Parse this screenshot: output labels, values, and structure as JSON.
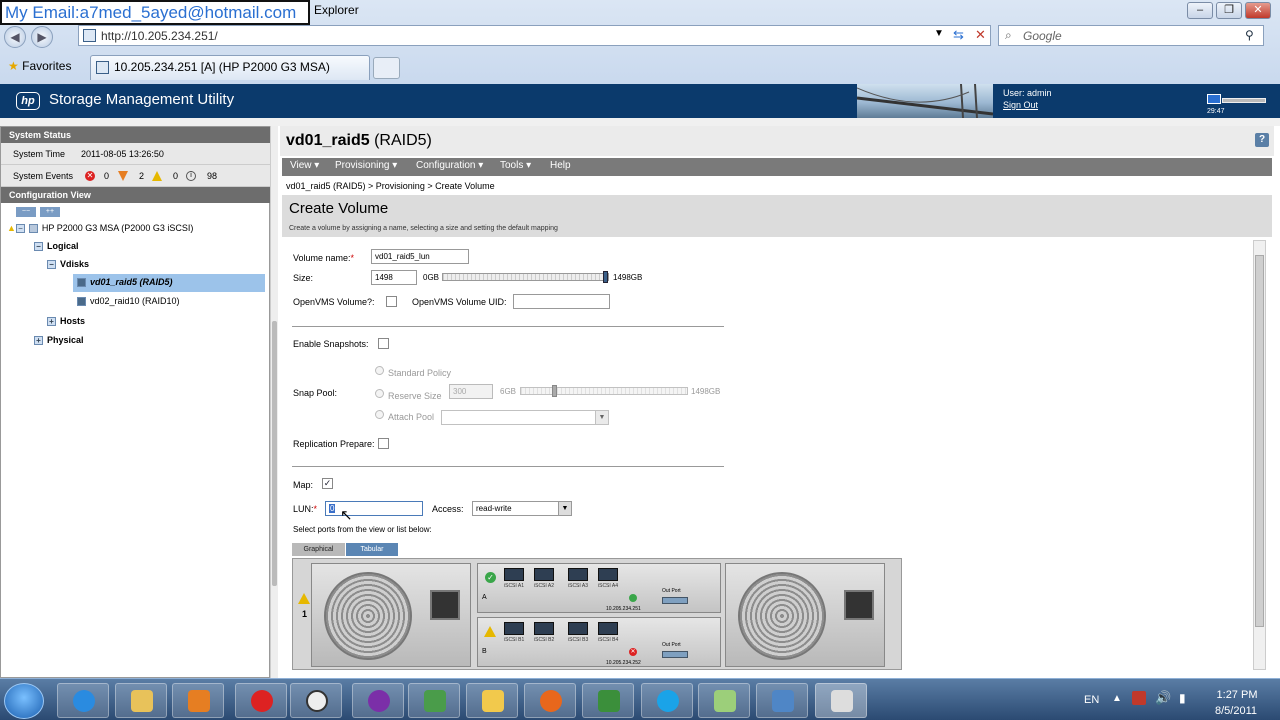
{
  "overlay": {
    "email_text": "My Email:a7med_5ayed@hotmail.com"
  },
  "browser": {
    "window_title_fragment": "Explorer",
    "address": "http://10.205.234.251/",
    "search_placeholder": "Google",
    "favorites_label": "Favorites",
    "tab_label": "10.205.234.251 [A] (HP P2000 G3 MSA)"
  },
  "app": {
    "title": "Storage Management Utility",
    "logo_text": "hp",
    "user_label": "User: admin",
    "sign_out": "Sign Out",
    "clock": "29:47"
  },
  "left": {
    "system_status": "System Status",
    "system_time_label": "System Time",
    "system_time_value": "2011-08-05 13:26:50",
    "system_events_label": "System Events",
    "events": {
      "critical": "0",
      "error": "2",
      "warning": "0",
      "info": "98"
    },
    "config_view": "Configuration View",
    "tree": {
      "system": "HP P2000 G3 MSA (P2000 G3 iSCSI)",
      "logical": "Logical",
      "vdisks": "Vdisks",
      "vd01": "vd01_raid5 (RAID5)",
      "vd02": "vd02_raid10 (RAID10)",
      "hosts": "Hosts",
      "physical": "Physical"
    }
  },
  "main": {
    "title_name": "vd01_raid5",
    "title_raid": "(RAID5)",
    "menu": [
      "View ▾",
      "Provisioning ▾",
      "Configuration ▾",
      "Tools ▾",
      "Help"
    ],
    "breadcrumb": "vd01_raid5 (RAID5) > Provisioning > Create Volume",
    "panel_title": "Create Volume",
    "panel_desc": "Create a volume by assigning a name, selecting a size and setting the default mapping",
    "form": {
      "volume_name_label": "Volume name:",
      "volume_name_value": "vd01_raid5_lun",
      "size_label": "Size:",
      "size_value": "1498",
      "size_min": "0GB",
      "size_max": "1498GB",
      "size_fraction": 1.0,
      "openvms_label": "OpenVMS Volume?:",
      "openvms_uid_label": "OpenVMS Volume UID:",
      "enable_snapshots_label": "Enable Snapshots:",
      "snap_pool_label": "Snap Pool:",
      "standard_policy": "Standard Policy",
      "reserve_size": "Reserve Size",
      "reserve_value": "300",
      "reserve_min": "6GB",
      "reserve_max": "1498GB",
      "attach_pool": "Attach Pool",
      "replication_label": "Replication Prepare:",
      "map_label": "Map:",
      "lun_label": "LUN:",
      "lun_value": "0",
      "access_label": "Access:",
      "access_value": "read-write",
      "ports_hint": "Select ports from the view or list below:",
      "view_tabs": [
        "Graphical",
        "Tabular"
      ]
    },
    "enclosure": {
      "enclosure_number": "1",
      "controller_a": "A",
      "controller_b": "B",
      "ports_a": [
        "iSCSI A1",
        "iSCSI A2",
        "iSCSI A3",
        "iSCSI A4"
      ],
      "ports_b": [
        "iSCSI B1",
        "iSCSI B2",
        "iSCSI B3",
        "iSCSI B4"
      ],
      "out_port": "Out Port",
      "ip_a": "10.205.234.251",
      "ip_b": "10.205.234.252"
    }
  },
  "taskbar": {
    "lang": "EN",
    "time": "1:27 PM",
    "date": "8/5/2011"
  }
}
